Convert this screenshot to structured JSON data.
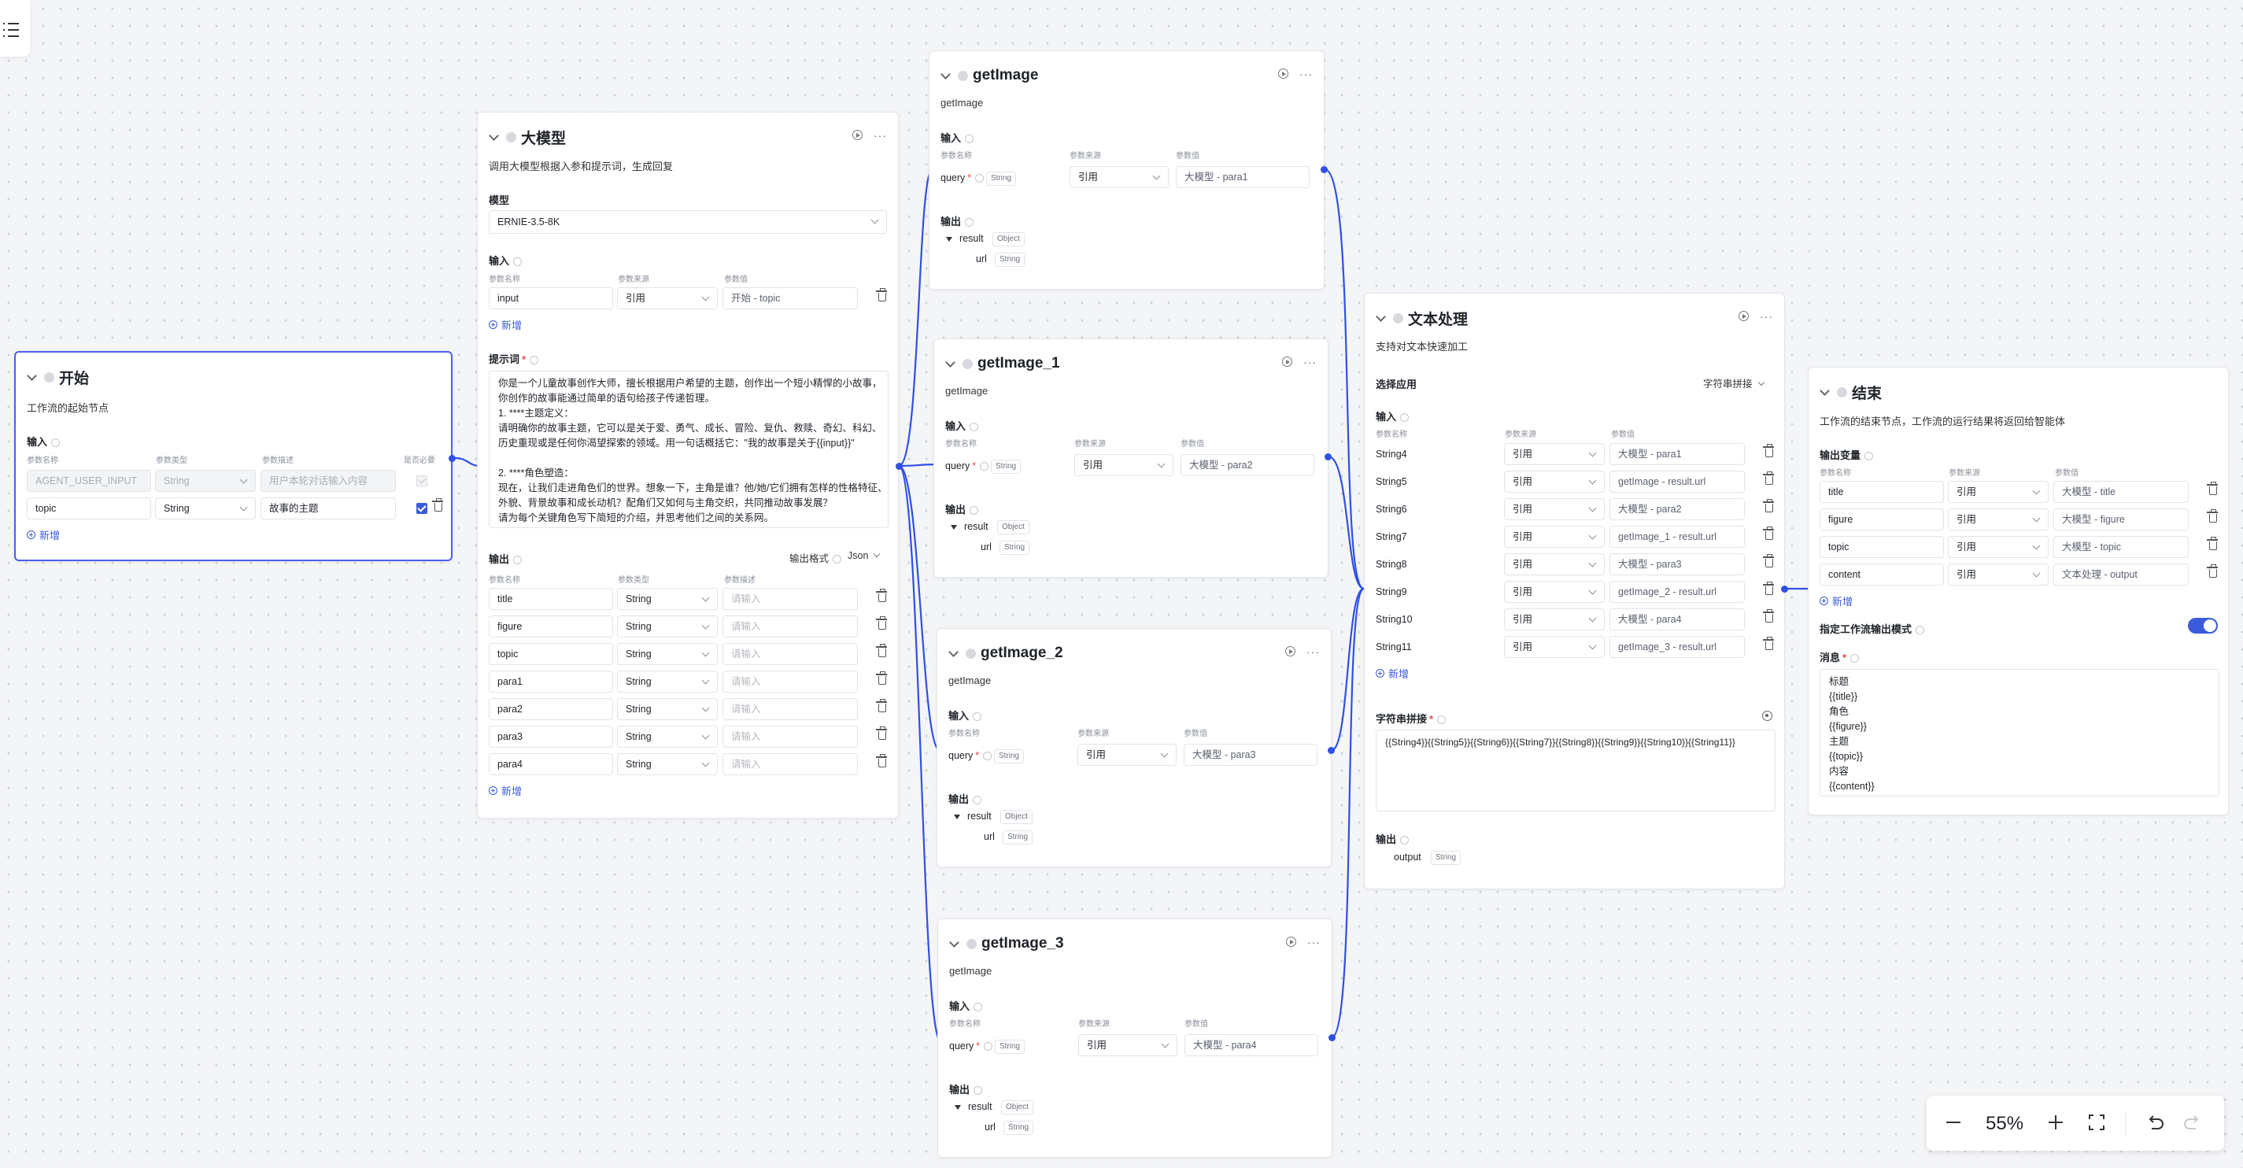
{
  "start": {
    "title": "开始",
    "desc": "工作流的起始节点",
    "input_label": "输入",
    "col_name": "参数名称",
    "col_type": "参数类型",
    "col_desc": "参数描述",
    "col_required": "是否必要",
    "rows": [
      {
        "name": "AGENT_USER_INPUT",
        "type": "String",
        "desc": "用户本轮对话输入内容"
      },
      {
        "name": "topic",
        "type": "String",
        "desc": "故事的主题"
      }
    ],
    "add": "新增"
  },
  "llm": {
    "title": "大模型",
    "desc": "调用大模型根据入参和提示词，生成回复",
    "model_label": "模型",
    "model": "ERNIE-3.5-8K",
    "input_label": "输入",
    "col_name": "参数名称",
    "col_source": "参数来源",
    "col_value": "参数值",
    "input_row": {
      "name": "input",
      "source": "引用",
      "value": "开始 - topic"
    },
    "add": "新增",
    "prompt_label": "提示词",
    "prompt_lines": [
      "你是一个儿童故事创作大师，擅长根据用户希望的主题，创作出一个短小精悍的小故事，",
      "你创作的故事能通过简单的语句给孩子传递哲理。",
      "1. ****主题定义：",
      "请明确你的故事主题，它可以是关于爱、勇气、成长、冒险、复仇、救赎、奇幻、科幻、",
      "历史重现或是任何你渴望探索的领域。用一句话概括它：\"我的故事是关于{{input}}\"",
      "",
      "2. ****角色塑造：",
      "现在，让我们走进角色们的世界。想象一下，主角是谁？他/她/它们拥有怎样的性格特征、",
      "外貌、背景故事和成长动机？配角们又如何与主角交织，共同推动故事发展？",
      "请为每个关键角色写下简短的介绍，并思考他们之间的关系网。"
    ],
    "output_label": "输出",
    "output_format_label": "输出格式",
    "output_format": "Json",
    "col_type": "参数类型",
    "col_desc": "参数描述",
    "outputs": [
      {
        "name": "title",
        "type": "String"
      },
      {
        "name": "figure",
        "type": "String"
      },
      {
        "name": "topic",
        "type": "String"
      },
      {
        "name": "para1",
        "type": "String"
      },
      {
        "name": "para2",
        "type": "String"
      },
      {
        "name": "para3",
        "type": "String"
      },
      {
        "name": "para4",
        "type": "String"
      }
    ],
    "placeholder": "请输入",
    "add2": "新增"
  },
  "getimage_nodes": [
    {
      "title": "getImage",
      "desc": "getImage",
      "value": "大模型 - para1"
    },
    {
      "title": "getImage_1",
      "desc": "getImage",
      "value": "大模型 - para2"
    },
    {
      "title": "getImage_2",
      "desc": "getImage",
      "value": "大模型 - para3"
    },
    {
      "title": "getImage_3",
      "desc": "getImage",
      "value": "大模型 - para4"
    }
  ],
  "getimage_common": {
    "input_label": "输入",
    "col_name": "参数名称",
    "col_source": "参数来源",
    "col_value": "参数值",
    "param": "query",
    "param_type": "String",
    "source": "引用",
    "output_label": "输出",
    "out_result": "result",
    "out_result_type": "Object",
    "out_url": "url",
    "out_url_type": "String"
  },
  "text": {
    "title": "文本处理",
    "desc": "支持对文本快速加工",
    "select_label": "选择应用",
    "select_value": "字符串拼接",
    "input_label": "输入",
    "col_name": "参数名称",
    "col_source": "参数来源",
    "col_value": "参数值",
    "rows": [
      {
        "name": "String4",
        "source": "引用",
        "value": "大模型 - para1"
      },
      {
        "name": "String5",
        "source": "引用",
        "value": "getImage - result.url"
      },
      {
        "name": "String6",
        "source": "引用",
        "value": "大模型 - para2"
      },
      {
        "name": "String7",
        "source": "引用",
        "value": "getImage_1 - result.url"
      },
      {
        "name": "String8",
        "source": "引用",
        "value": "大模型 - para3"
      },
      {
        "name": "String9",
        "source": "引用",
        "value": "getImage_2 - result.url"
      },
      {
        "name": "String10",
        "source": "引用",
        "value": "大模型 - para4"
      },
      {
        "name": "String11",
        "source": "引用",
        "value": "getImage_3 - result.url"
      }
    ],
    "add": "新增",
    "concat_label": "字符串拼接",
    "concat_value": "{{String4}}{{String5}}{{String6}}{{String7}}{{String8}}{{String9}}{{String10}}{{String11}}",
    "output_label": "输出",
    "output_name": "output",
    "output_type": "String"
  },
  "end": {
    "title": "结束",
    "desc": "工作流的结束节点，工作流的运行结果将返回给智能体",
    "output_var_label": "输出变量",
    "col_name": "参数名称",
    "col_source": "参数来源",
    "col_value": "参数值",
    "rows": [
      {
        "name": "title",
        "source": "引用",
        "value": "大模型 - title"
      },
      {
        "name": "figure",
        "source": "引用",
        "value": "大模型 - figure"
      },
      {
        "name": "topic",
        "source": "引用",
        "value": "大模型 - topic"
      },
      {
        "name": "content",
        "source": "引用",
        "value": "文本处理 - output"
      }
    ],
    "add": "新增",
    "mode_label": "指定工作流输出模式",
    "message_label": "消息",
    "message_lines": [
      "标题",
      "{{title}}",
      "角色",
      "{{figure}}",
      "主题",
      "{{topic}}",
      "内容",
      "{{content}}"
    ]
  },
  "toolbar": {
    "zoom": "55%"
  },
  "colors": {
    "accent": "#3b5bdb",
    "edge": "#2f50e6",
    "selected_border": "#4d5ef0"
  }
}
